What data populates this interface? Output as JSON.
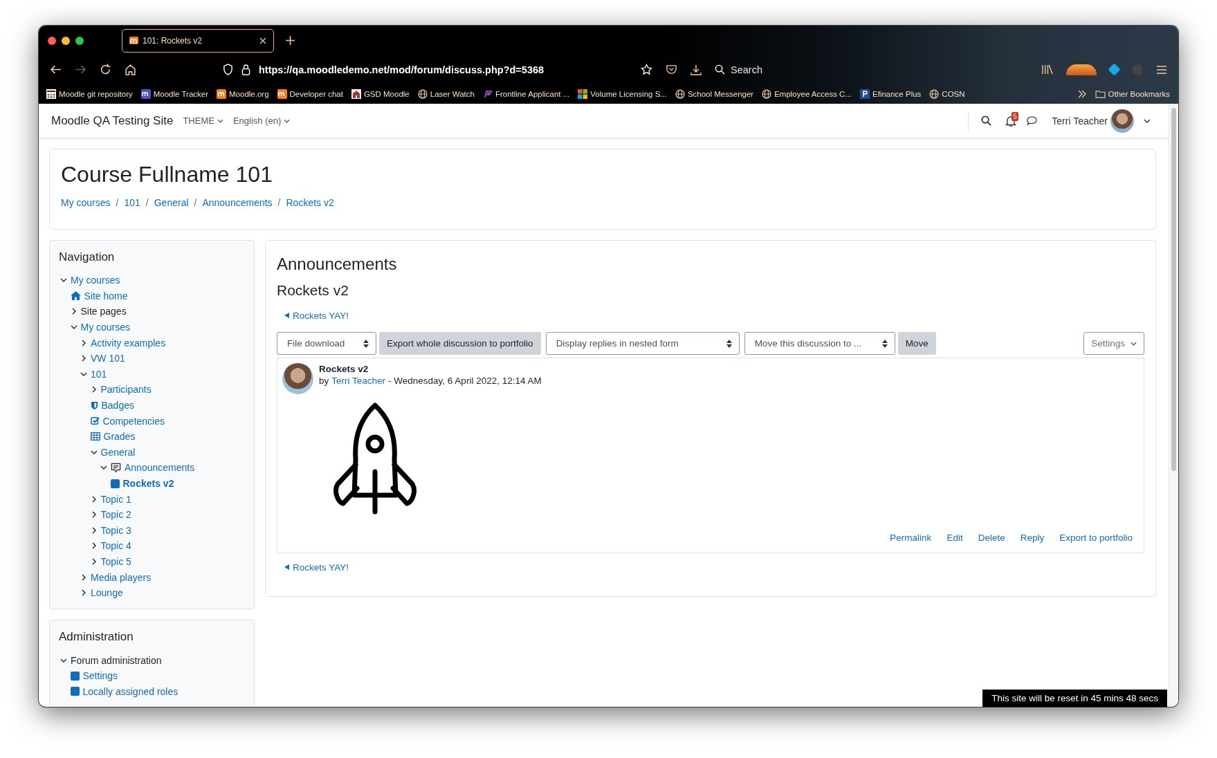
{
  "browser": {
    "tab": {
      "title": "101: Rockets v2",
      "selected": true
    },
    "url": "https://qa.moodledemo.net/mod/forum/discuss.php?d=5368",
    "search": {
      "placeholder": "Search"
    },
    "bookmarks": [
      {
        "label": "Moodle git repository",
        "kind": "dots"
      },
      {
        "label": "Moodle Tracker",
        "kind": "moodle",
        "color": "#4654c4"
      },
      {
        "label": "Moodle.org",
        "kind": "moodle",
        "color": "#f98012"
      },
      {
        "label": "Developer chat",
        "kind": "moodle",
        "color": "#f98012"
      },
      {
        "label": "GSD Moodle",
        "kind": "school"
      },
      {
        "label": "Laser Watch",
        "kind": "globe"
      },
      {
        "label": "Frontline Applicant ...",
        "kind": "frontline"
      },
      {
        "label": "Volume Licensing S...",
        "kind": "windows"
      },
      {
        "label": "School Messenger",
        "kind": "globe"
      },
      {
        "label": "Employee Access C...",
        "kind": "globe"
      },
      {
        "label": "Efinance Plus",
        "kind": "pbox"
      },
      {
        "label": "COSN",
        "kind": "globe"
      }
    ],
    "other_bookmarks": "Other Bookmarks"
  },
  "navbar": {
    "site_name": "Moodle QA Testing Site",
    "menus": [
      "THEME",
      "English (en)"
    ],
    "notifications": "5",
    "user": "Terri Teacher"
  },
  "course": {
    "title": "Course Fullname 101",
    "breadcrumb": [
      "My courses",
      "101",
      "General",
      "Announcements",
      "Rockets v2"
    ],
    "separator": "/"
  },
  "navigation": {
    "title": "Navigation",
    "tree": [
      {
        "label": "My courses",
        "kind": "branch",
        "expanded": true,
        "link": true,
        "current": false,
        "children": [
          {
            "label": "Site home",
            "kind": "home",
            "link": true,
            "current": false
          },
          {
            "label": "Site pages",
            "kind": "branch",
            "expanded": false,
            "link": false,
            "current": false
          },
          {
            "label": "My courses",
            "kind": "branch",
            "expanded": true,
            "link": true,
            "current": false,
            "children": [
              {
                "label": "Activity examples",
                "kind": "branch",
                "expanded": false,
                "link": true,
                "current": false
              },
              {
                "label": "VW 101",
                "kind": "branch",
                "expanded": false,
                "link": true,
                "current": false
              },
              {
                "label": "101",
                "kind": "branch",
                "expanded": true,
                "link": true,
                "current": false,
                "children": [
                  {
                    "label": "Participants",
                    "kind": "branch",
                    "expanded": false,
                    "link": true,
                    "current": false
                  },
                  {
                    "label": "Badges",
                    "kind": "badges",
                    "link": true,
                    "current": false
                  },
                  {
                    "label": "Competencies",
                    "kind": "competencies",
                    "link": true,
                    "current": false
                  },
                  {
                    "label": "Grades",
                    "kind": "grades",
                    "link": true,
                    "current": false
                  },
                  {
                    "label": "General",
                    "kind": "branch",
                    "expanded": true,
                    "link": true,
                    "current": false,
                    "children": [
                      {
                        "label": "Announcements",
                        "kind": "forum",
                        "expanded": true,
                        "link": true,
                        "current": false,
                        "children": [
                          {
                            "label": "Rockets v2",
                            "kind": "activity",
                            "link": true,
                            "current": true
                          }
                        ]
                      }
                    ]
                  },
                  {
                    "label": "Topic 1",
                    "kind": "branch",
                    "expanded": false,
                    "link": true,
                    "current": false
                  },
                  {
                    "label": "Topic 2",
                    "kind": "branch",
                    "expanded": false,
                    "link": true,
                    "current": false
                  },
                  {
                    "label": "Topic 3",
                    "kind": "branch",
                    "expanded": false,
                    "link": true,
                    "current": false
                  },
                  {
                    "label": "Topic 4",
                    "kind": "branch",
                    "expanded": false,
                    "link": true,
                    "current": false
                  },
                  {
                    "label": "Topic 5",
                    "kind": "branch",
                    "expanded": false,
                    "link": true,
                    "current": false
                  }
                ]
              },
              {
                "label": "Media players",
                "kind": "branch",
                "expanded": false,
                "link": true,
                "current": false
              },
              {
                "label": "Lounge",
                "kind": "branch",
                "expanded": false,
                "link": true,
                "current": false
              }
            ]
          }
        ]
      }
    ]
  },
  "administration": {
    "title": "Administration",
    "tree": [
      {
        "label": "Forum administration",
        "kind": "branch",
        "expanded": true,
        "link": false,
        "current": false,
        "children": [
          {
            "label": "Settings",
            "kind": "activity",
            "link": true,
            "current": false
          },
          {
            "label": "Locally assigned roles",
            "kind": "activity",
            "link": true,
            "current": false
          }
        ]
      }
    ]
  },
  "forum": {
    "title": "Announcements",
    "discussion": "Rockets v2",
    "prev_link": "Rockets YAY!",
    "toolbar": [
      {
        "kind": "select",
        "label": "File download"
      },
      {
        "kind": "button",
        "label": "Export whole discussion to portfolio"
      },
      {
        "kind": "select",
        "label": "Display replies in nested form"
      },
      {
        "kind": "select",
        "label": "Move this discussion to ..."
      },
      {
        "kind": "button",
        "label": "Move"
      }
    ],
    "settings": "Settings",
    "post": {
      "subject": "Rockets v2",
      "by": "by",
      "author": "Terri Teacher",
      "date": "- Wednesday, 6 April 2022, 12:14 AM",
      "actions": [
        "Permalink",
        "Edit",
        "Delete",
        "Reply",
        "Export to portfolio"
      ]
    },
    "next_link": "Rockets YAY!"
  },
  "notice": "This site will be reset in 45 mins 48 secs"
}
